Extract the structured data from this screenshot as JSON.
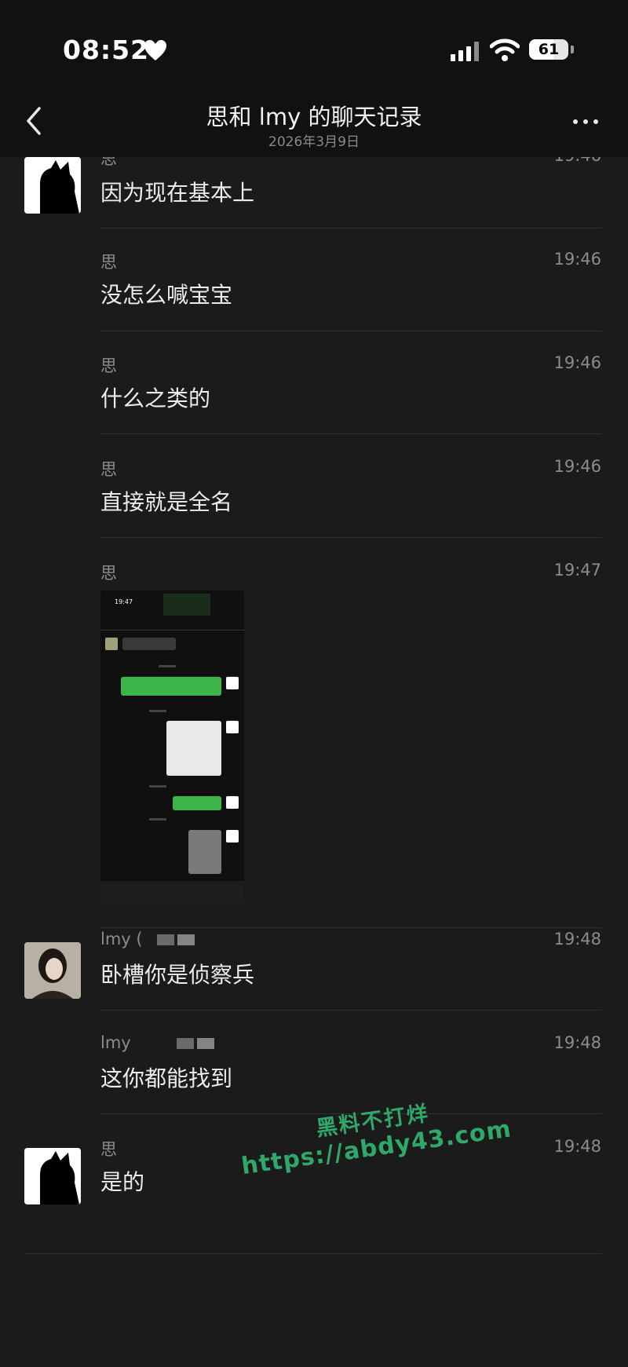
{
  "status_bar": {
    "time": "08:52",
    "battery": "61",
    "battery_level": 0.61
  },
  "header": {
    "title": "思和 lmy 的聊天记录",
    "subtitle": "2026年3月9日"
  },
  "messages": [
    {
      "sender": "思",
      "time": "19:46",
      "text": "因为现在基本上"
    },
    {
      "sender": "思",
      "time": "19:46",
      "text": "没怎么喊宝宝"
    },
    {
      "sender": "思",
      "time": "19:46",
      "text": "什么之类的"
    },
    {
      "sender": "思",
      "time": "19:46",
      "text": "直接就是全名"
    },
    {
      "sender": "思",
      "time": "19:47",
      "text": "",
      "image": "chat-screenshot-thumbnail"
    },
    {
      "sender": "lmy (",
      "time": "19:48",
      "text": "卧槽你是侦察兵"
    },
    {
      "sender": "lmy",
      "time": "19:48",
      "text": "这你都能找到"
    },
    {
      "sender": "思",
      "time": "19:48",
      "text": "是的"
    }
  ],
  "thumbnail": {
    "time": "19:47"
  },
  "watermark": {
    "line1": "黑料不打烊",
    "line2": "https://abdy43.com"
  },
  "colors": {
    "background": "#1b1b1b",
    "header": "#111111",
    "accent_green": "#3cb449",
    "watermark": "#2fa86a"
  }
}
